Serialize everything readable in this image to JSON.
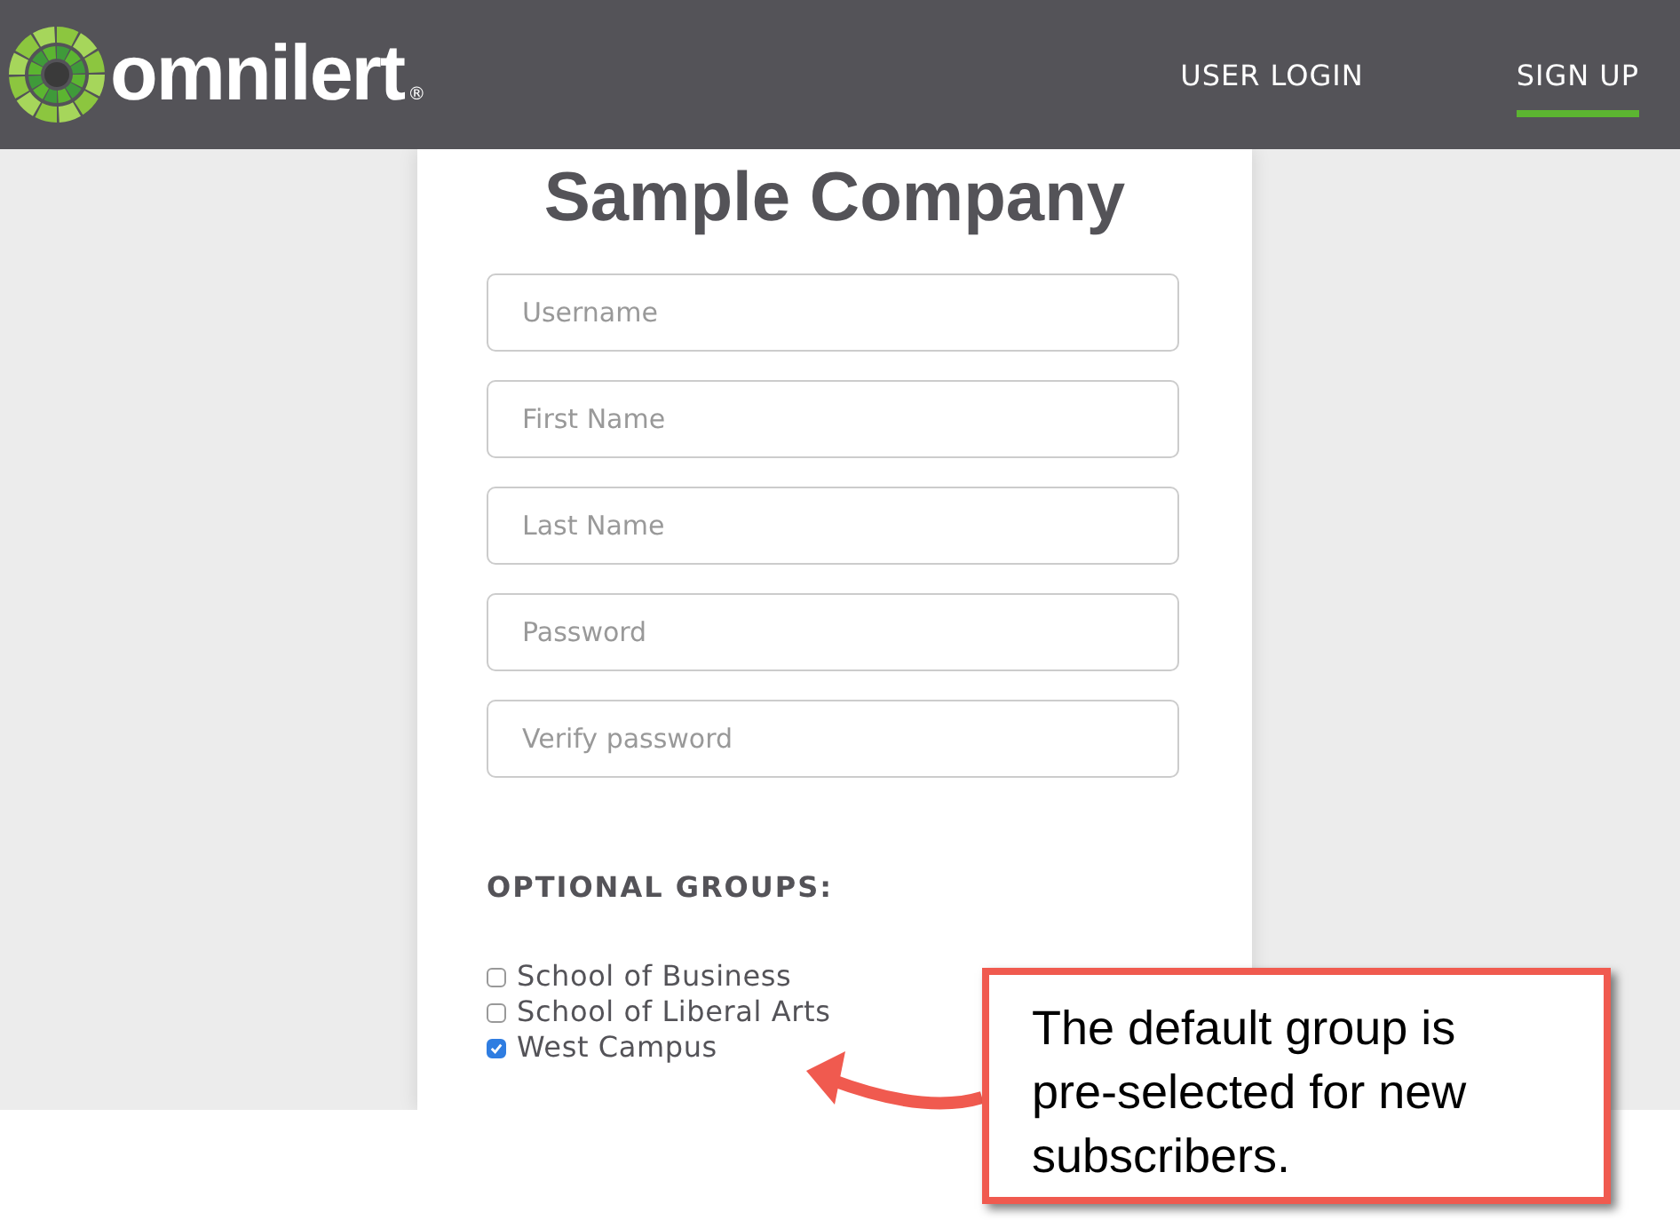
{
  "header": {
    "logo": {
      "name": "omnilert",
      "mark": "®"
    },
    "nav": [
      {
        "label": "USER LOGIN",
        "selected": false
      },
      {
        "label": "SIGN UP",
        "selected": true
      }
    ]
  },
  "form": {
    "title": "Sample Company",
    "fields": [
      {
        "placeholder": "Username"
      },
      {
        "placeholder": "First Name"
      },
      {
        "placeholder": "Last Name"
      },
      {
        "placeholder": "Password"
      },
      {
        "placeholder": "Verify password"
      }
    ],
    "groups_heading": "OPTIONAL GROUPS:",
    "groups": [
      {
        "label": "School of Business",
        "checked": false
      },
      {
        "label": "School of Liberal Arts",
        "checked": false
      },
      {
        "label": "West Campus",
        "checked": true
      }
    ]
  },
  "callout": {
    "text": "The default group is pre-selected for new subscribers."
  }
}
